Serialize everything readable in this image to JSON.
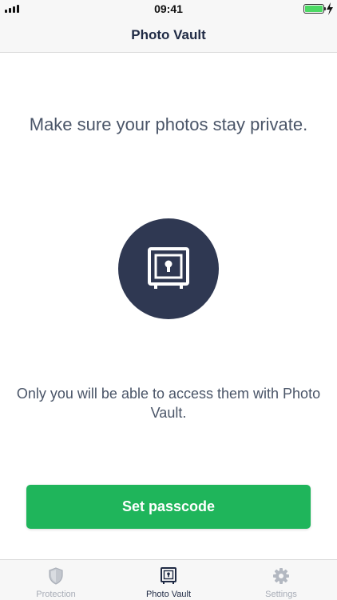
{
  "status_bar": {
    "time": "09:41"
  },
  "nav": {
    "title": "Photo Vault"
  },
  "main": {
    "headline": "Make sure your photos stay private.",
    "vault_icon": "safe-icon",
    "subtext": "Only you will be able to access them with Photo Vault.",
    "cta_label": "Set passcode"
  },
  "tabs": [
    {
      "label": "Protection",
      "icon": "shield-icon",
      "active": false
    },
    {
      "label": "Photo Vault",
      "icon": "safe-icon",
      "active": true
    },
    {
      "label": "Settings",
      "icon": "gear-icon",
      "active": false
    }
  ],
  "colors": {
    "accent": "#1fb55b",
    "vault_circle": "#2f3852",
    "text_primary": "#1f2a44",
    "text_secondary": "#4a5568",
    "tab_inactive": "#a8adb7",
    "battery": "#4cd964"
  }
}
